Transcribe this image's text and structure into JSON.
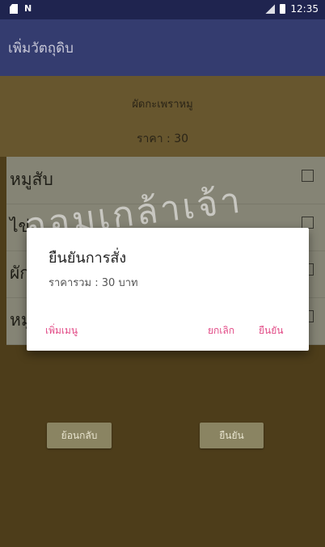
{
  "status_bar": {
    "time": "12:35"
  },
  "toolbar": {
    "title": "เพิ่มวัตถุดิบ"
  },
  "order": {
    "name": "ผัดกะเพราหมู",
    "price": "ราคา : 30"
  },
  "list": [
    {
      "label": "หมูสับ"
    },
    {
      "label": "ไข่"
    },
    {
      "label": "ผัก"
    },
    {
      "label": "หมูกรอบ"
    }
  ],
  "buttons": {
    "back": "ย้อนกลับ",
    "confirm": "ยืนยัน"
  },
  "dialog": {
    "title": "ยืนยันการสั่ง",
    "message": "ราคารวม : 30 บาท",
    "add_menu": "เพิ่มเมนู",
    "cancel": "ยกเลิก",
    "confirm": "ยืนยัน"
  },
  "watermark": {
    "text": "จอมเกล้าเจ้า"
  },
  "colors": {
    "accent": "#e24a86",
    "toolbar": "#343c6f",
    "background": "#6b5524"
  }
}
